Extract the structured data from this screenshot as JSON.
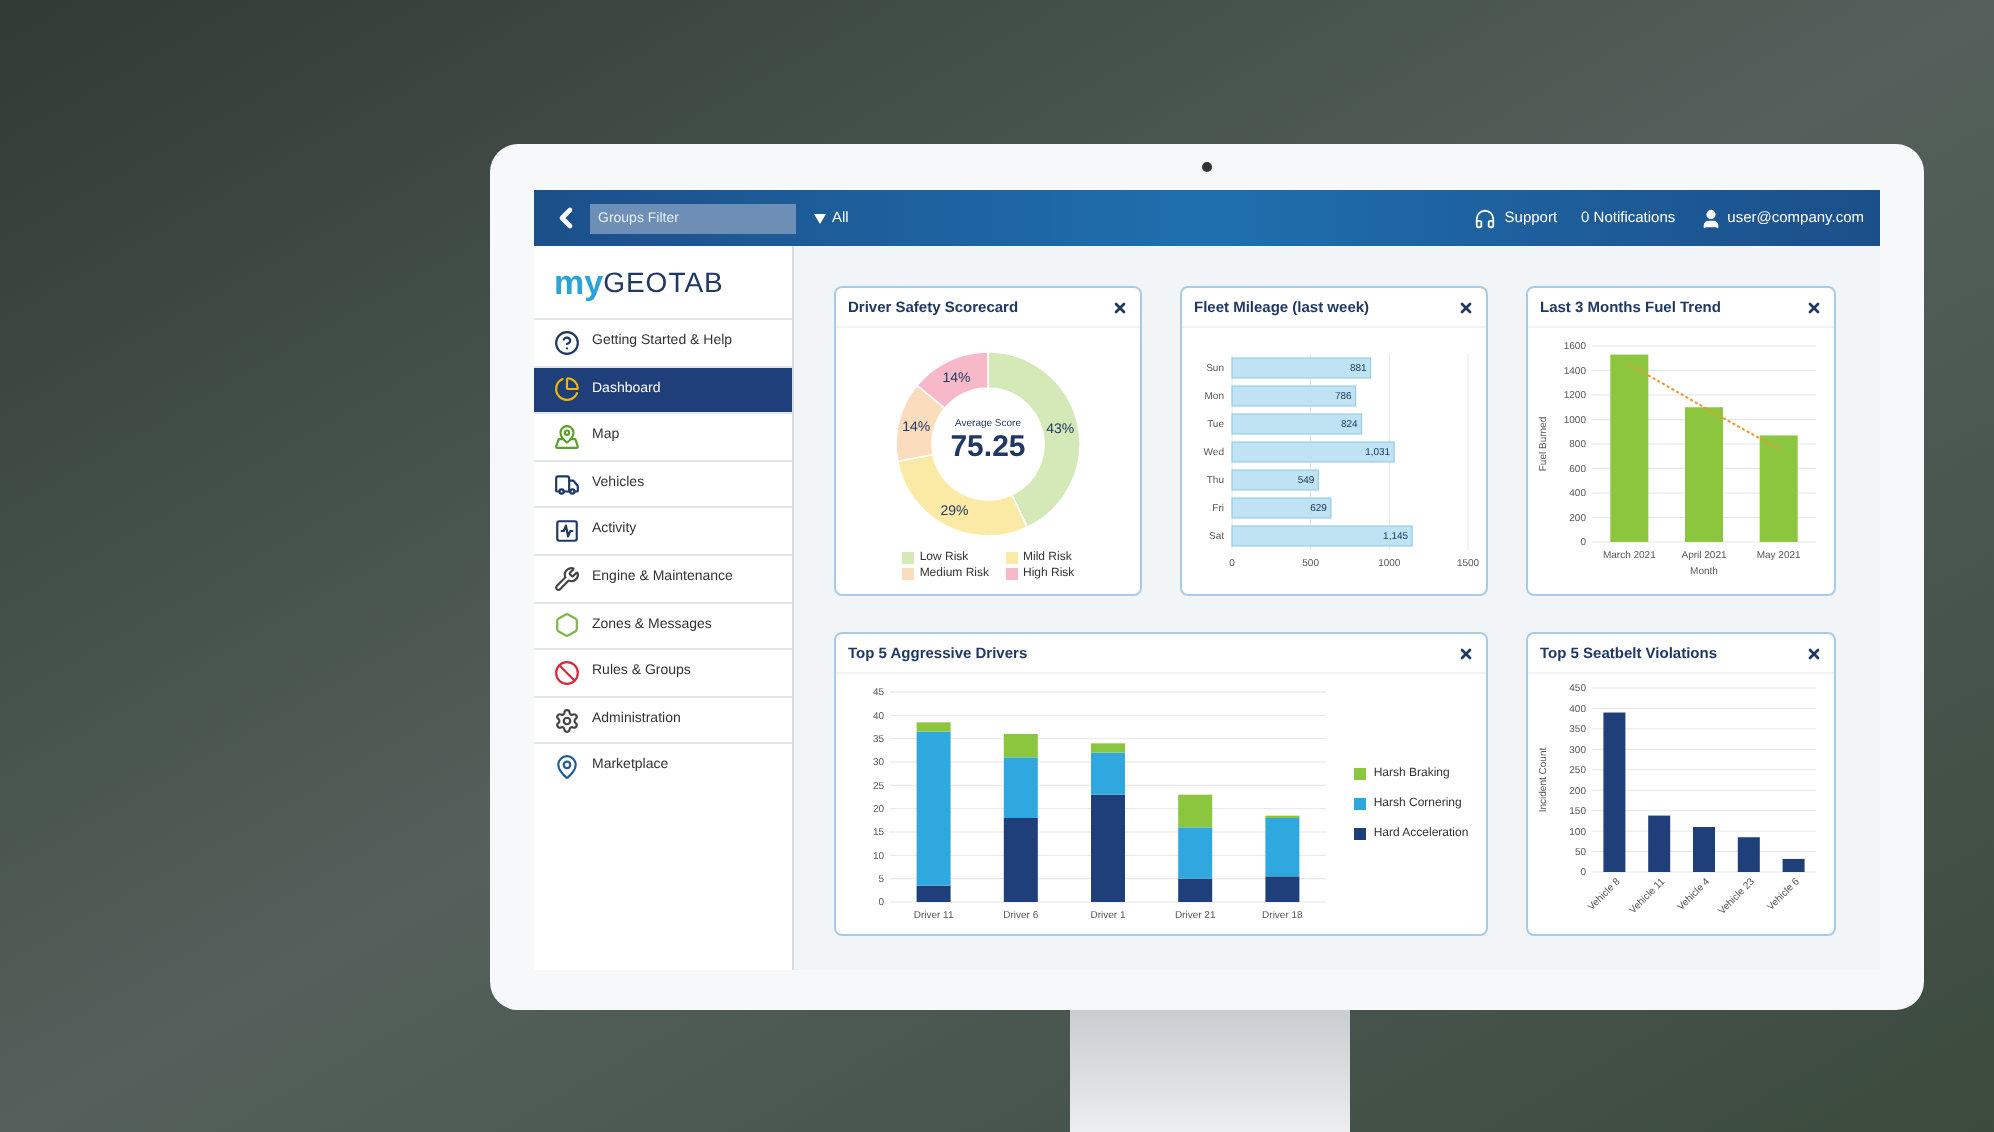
{
  "topbar": {
    "filter_placeholder": "Groups Filter",
    "filter_value": "All",
    "support": "Support",
    "notifications": "0 Notifications",
    "user": "user@company.com"
  },
  "sidebar": {
    "logo": {
      "prefix": "my",
      "name": "GEOTAB"
    },
    "items": [
      {
        "label": "Getting Started & Help",
        "selected": false
      },
      {
        "label": "Dashboard",
        "selected": true
      },
      {
        "label": "Map",
        "selected": false
      },
      {
        "label": "Vehicles",
        "selected": false
      },
      {
        "label": "Activity",
        "selected": false
      },
      {
        "label": "Engine & Maintenance",
        "selected": false
      },
      {
        "label": "Zones & Messages",
        "selected": false
      },
      {
        "label": "Rules & Groups",
        "selected": false
      },
      {
        "label": "Administration",
        "selected": false
      },
      {
        "label": "Marketplace",
        "selected": false
      }
    ]
  },
  "widgets": [
    {
      "title": "Driver Safety Scorecard",
      "center_caption": "Average Score",
      "center_value": "75.25",
      "chart_data": {
        "type": "donut",
        "categories": [
          "Low Risk",
          "Mild Risk",
          "Medium Risk",
          "High Risk"
        ],
        "colors": [
          "#d4e8b8",
          "#fbeaa6",
          "#fbdcbc",
          "#f7b9c8"
        ],
        "values": [
          43,
          29,
          14,
          14
        ],
        "value_labels": [
          "43%",
          "29%",
          "14%",
          "14%"
        ]
      }
    },
    {
      "title": "Fleet Mileage (last week)",
      "chart_data": {
        "type": "bar",
        "orientation": "horizontal",
        "grid": true,
        "categories": [
          "Sun",
          "Mon",
          "Tue",
          "Wed",
          "Thu",
          "Fri",
          "Sat"
        ],
        "series": [
          {
            "color": "#bfe3f2",
            "values": [
              881,
              786,
              824,
              1031,
              549,
              629,
              1145
            ]
          }
        ],
        "value_labels": [
          "881",
          "786",
          "824",
          "1,031",
          "549",
          "629",
          "1,145"
        ],
        "xlim": [
          0,
          1500
        ],
        "xticks": [
          0,
          500,
          1000,
          1500
        ]
      }
    },
    {
      "title": "Last 3 Months Fuel Trend",
      "chart_data": {
        "type": "bar",
        "stacked": false,
        "grid": true,
        "xlabel": "Month",
        "ylabel": "Fuel Burned",
        "categories": [
          "March 2021",
          "April 2021",
          "May 2021"
        ],
        "series": [
          {
            "type": "bar",
            "color": "#8cc63f",
            "values": [
              1530,
              1100,
              870
            ]
          },
          {
            "type": "line",
            "line_style": "dotted",
            "color": "#f0932b",
            "values": [
              1450,
              1100,
              760
            ]
          }
        ],
        "ylim": [
          0,
          1600
        ],
        "yticks": [
          0,
          200,
          400,
          600,
          800,
          1000,
          1200,
          1400,
          1600
        ]
      }
    },
    {
      "title": "Top 5 Aggressive Drivers",
      "chart_data": {
        "type": "bar",
        "stacked": true,
        "grid": true,
        "categories": [
          "Driver 11",
          "Driver 6",
          "Driver 1",
          "Driver 21",
          "Driver 18"
        ],
        "series": [
          {
            "name": "Hard Acceleration",
            "color": "#1f3f7a",
            "values": [
              3.5,
              18,
              23,
              5,
              5.5
            ]
          },
          {
            "name": "Harsh Cornering",
            "color": "#2fa8e0",
            "values": [
              33,
              13,
              9,
              11,
              12.5
            ]
          },
          {
            "name": "Harsh Braking",
            "color": "#8cc63f",
            "values": [
              2,
              5,
              2,
              7,
              0.5
            ]
          }
        ],
        "ylim": [
          0,
          45
        ],
        "yticks": [
          0,
          5,
          10,
          15,
          20,
          25,
          30,
          35,
          40,
          45
        ]
      }
    },
    {
      "title": "Top 5 Seatbelt Violations",
      "chart_data": {
        "type": "bar",
        "stacked": false,
        "grid": true,
        "ylabel": "Incident Count",
        "categories": [
          "Vehicle 8",
          "Vehicle 11",
          "Vehicle 4",
          "Vehicle 23",
          "Vehicle 6"
        ],
        "series": [
          {
            "color": "#1f3f7a",
            "values": [
              390,
              138,
              110,
              85,
              32
            ]
          }
        ],
        "ylim": [
          0,
          450
        ],
        "yticks": [
          0,
          50,
          100,
          150,
          200,
          250,
          300,
          350,
          400,
          450
        ]
      }
    }
  ]
}
